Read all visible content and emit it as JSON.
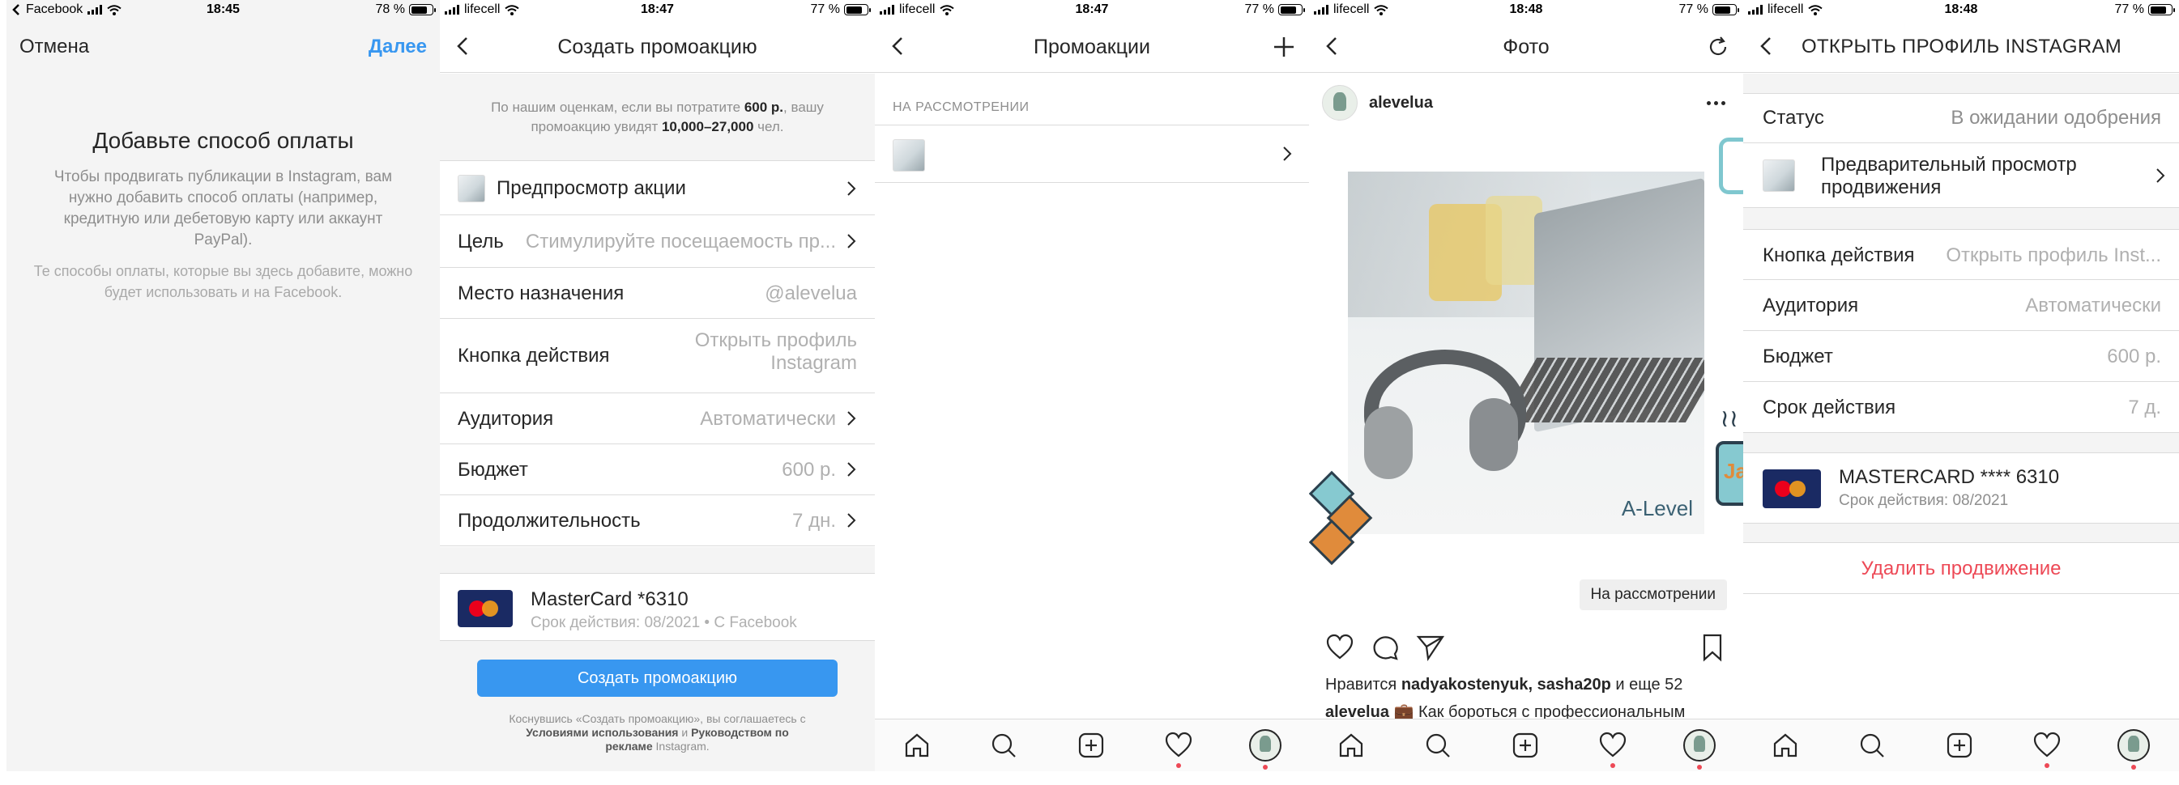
{
  "screen1": {
    "status": {
      "carrier": "Facebook",
      "time": "18:45",
      "battery": "78 %",
      "battery_level": 0.78
    },
    "cancel_label": "Отмена",
    "next_label": "Далее",
    "title": "Добавьте способ оплаты",
    "description": "Чтобы продвигать публикации в Instagram, вам нужно добавить способ оплаты (например, кредитную или дебетовую карту или аккаунт PayPal).",
    "note": "Те способы оплаты, которые вы здесь добавите, можно будет использовать и на Facebook."
  },
  "screen2": {
    "status": {
      "carrier": "lifecell",
      "time": "18:47",
      "battery": "77 %",
      "battery_level": 0.77
    },
    "title": "Создать промоакцию",
    "estimate": {
      "prefix": "По нашим оценкам, если вы потратите ",
      "amount": "600 р.",
      "middle": ", вашу промоакцию увидят ",
      "reach": "10,000–27,000",
      "suffix": " чел."
    },
    "rows": [
      {
        "label": "Предпросмотр акции",
        "value": ""
      },
      {
        "label": "Цель",
        "value": "Стимулируйте посещаемость пр..."
      },
      {
        "label": "Место назначения",
        "value": "@alevelua"
      },
      {
        "label": "Кнопка действия",
        "value_line1": "Открыть профиль",
        "value_line2": "Instagram"
      },
      {
        "label": "Аудитория",
        "value": "Автоматически"
      },
      {
        "label": "Бюджет",
        "value": "600 р."
      },
      {
        "label": "Продолжительность",
        "value": "7 дн."
      }
    ],
    "card": {
      "name": "MasterCard *6310",
      "sub": "Срок действия: 08/2021 • С Facebook"
    },
    "create_button": "Создать промоакцию",
    "terms": {
      "p1": "Коснувшись «Создать промоакцию», вы соглашаетесь с ",
      "l1": "Условиями использования",
      "p2": " и ",
      "l2": "Руководством по рекламе",
      "p3": " Instagram."
    }
  },
  "screen3": {
    "status": {
      "carrier": "lifecell",
      "time": "18:47",
      "battery": "77 %",
      "battery_level": 0.77
    },
    "title": "Промоакции",
    "section": "НА РАССМОТРЕНИИ"
  },
  "screen4": {
    "status": {
      "carrier": "lifecell",
      "time": "18:48",
      "battery": "77 %",
      "battery_level": 0.77
    },
    "title": "Фото",
    "username": "alevelua",
    "photo_brand": "A-Level",
    "deco_text": "Jav",
    "badge": "На рассмотрении",
    "likes": {
      "prefix": "Нравится ",
      "users": "nadyakostenyuk, sasha20p",
      "suffix": " и еще 52"
    },
    "caption": {
      "user": "alevelua",
      "text": " 💼 Как бороться с профессиональным"
    }
  },
  "screen5": {
    "status": {
      "carrier": "lifecell",
      "time": "18:48",
      "battery": "77 %",
      "battery_level": 0.77
    },
    "title": "ОТКРЫТЬ ПРОФИЛЬ INSTAGRAM",
    "status_row": {
      "label": "Статус",
      "value": "В ожидании одобрения"
    },
    "preview_row": {
      "label_line1": "Предварительный просмотр",
      "label_line2": "продвижения"
    },
    "rows": [
      {
        "label": "Кнопка действия",
        "value": "Открыть профиль Inst..."
      },
      {
        "label": "Аудитория",
        "value": "Автоматически"
      },
      {
        "label": "Бюджет",
        "value": "600 р."
      },
      {
        "label": "Срок действия",
        "value": "7 д."
      }
    ],
    "card": {
      "name": "MASTERCARD **** 6310",
      "sub": "Срок действия: 08/2021"
    },
    "delete_label": "Удалить продвижение"
  },
  "colors": {
    "accent": "#3897f0",
    "danger": "#ed4956",
    "text": "#262626",
    "muted": "#8e8e8e",
    "mastercard_bg": "#1a2a63"
  },
  "icons": {
    "tabbar": [
      "home-icon",
      "search-icon",
      "add-icon",
      "heart-icon",
      "profile-avatar"
    ]
  }
}
